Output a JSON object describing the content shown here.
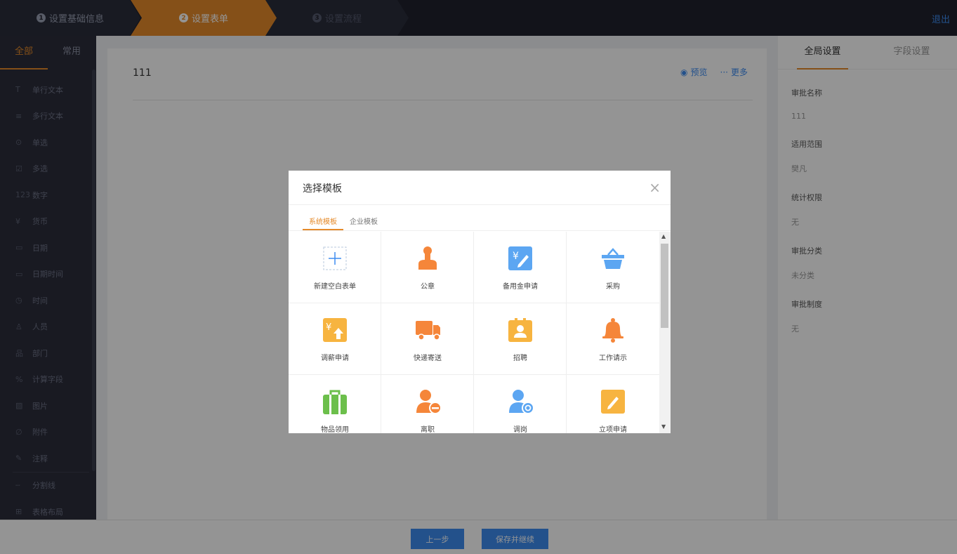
{
  "topbar": {
    "steps": [
      {
        "num": "1",
        "label": "设置基础信息"
      },
      {
        "num": "2",
        "label": "设置表单"
      },
      {
        "num": "3",
        "label": "设置流程"
      }
    ],
    "logout": "退出"
  },
  "sidebar": {
    "tabs": [
      "全部",
      "常用"
    ],
    "items": [
      {
        "icon": "T",
        "label": "单行文本"
      },
      {
        "icon": "≡",
        "label": "多行文本"
      },
      {
        "icon": "⊙",
        "label": "单选"
      },
      {
        "icon": "☑",
        "label": "多选"
      },
      {
        "icon": "123",
        "label": "数字"
      },
      {
        "icon": "¥",
        "label": "货币"
      },
      {
        "icon": "▭",
        "label": "日期"
      },
      {
        "icon": "▭",
        "label": "日期时间"
      },
      {
        "icon": "◷",
        "label": "时间"
      },
      {
        "icon": "♙",
        "label": "人员"
      },
      {
        "icon": "品",
        "label": "部门"
      },
      {
        "icon": "%",
        "label": "计算字段"
      },
      {
        "icon": "▨",
        "label": "图片"
      },
      {
        "icon": "∅",
        "label": "附件"
      },
      {
        "icon": "✎",
        "label": "注释"
      },
      {
        "icon": "┄",
        "label": "分割线"
      },
      {
        "icon": "⊞",
        "label": "表格布局"
      }
    ]
  },
  "canvas": {
    "title": "111",
    "preview": "预览",
    "more": "更多"
  },
  "rpanel": {
    "tabs": [
      "全局设置",
      "字段设置"
    ],
    "fields": [
      {
        "label": "审批名称",
        "value": "111"
      },
      {
        "label": "适用范围",
        "value": "樊凡"
      },
      {
        "label": "统计权限",
        "value": "无"
      },
      {
        "label": "审批分类",
        "value": "未分类"
      },
      {
        "label": "审批制度",
        "value": "无"
      }
    ]
  },
  "bottombar": {
    "prev": "上一步",
    "save": "保存并继续"
  },
  "modal": {
    "title": "选择模板",
    "close": "×",
    "tabs": [
      "系统模板",
      "企业模板"
    ],
    "templates": [
      {
        "label": "新建空白表单",
        "icon": "plus-icon"
      },
      {
        "label": "公章",
        "icon": "stamp-icon"
      },
      {
        "label": "备用金申请",
        "icon": "yuan-edit-icon"
      },
      {
        "label": "采购",
        "icon": "basket-icon"
      },
      {
        "label": "调薪申请",
        "icon": "yuan-up-icon"
      },
      {
        "label": "快递寄送",
        "icon": "truck-icon"
      },
      {
        "label": "招聘",
        "icon": "recruit-icon"
      },
      {
        "label": "工作请示",
        "icon": "bell-icon"
      },
      {
        "label": "物品领用",
        "icon": "bag-icon"
      },
      {
        "label": "离职",
        "icon": "user-minus-icon"
      },
      {
        "label": "调岗",
        "icon": "user-transfer-icon"
      },
      {
        "label": "立项申请",
        "icon": "pencil-icon"
      }
    ]
  },
  "colors": {
    "accent": "#e58a2a",
    "primary": "#3d8cf0",
    "topbar": "#20222e",
    "sidebar": "#2b2d3b"
  }
}
